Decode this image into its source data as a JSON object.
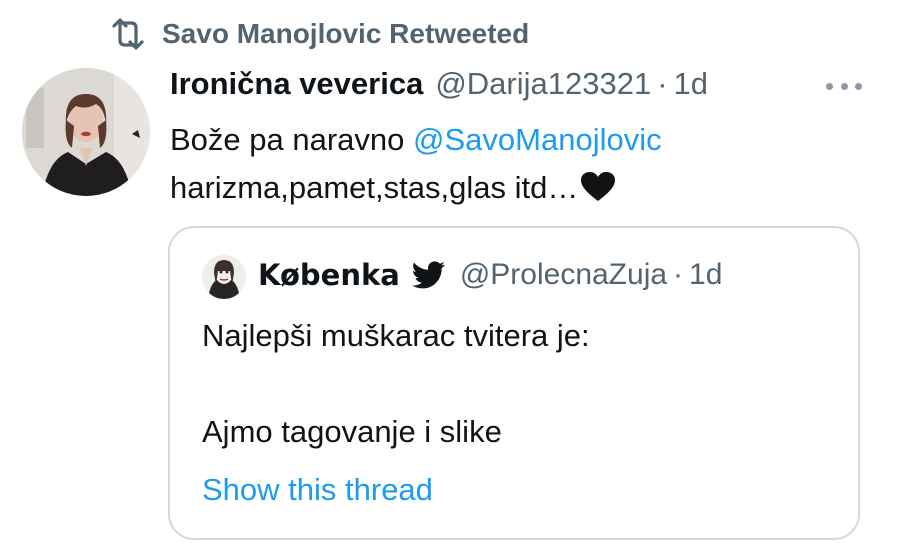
{
  "retweet": {
    "icon": "retweet-icon",
    "label": "Savo Manojlovic Retweeted"
  },
  "tweet": {
    "avatar_icon": "user-avatar",
    "display_name": "Ironična veverica",
    "handle": "@Darija123321",
    "separator": "·",
    "time": "1d",
    "more_icon": "more-options-icon",
    "text_line1_prefix": "Bože pa naravno ",
    "mention": "@SavoManojlovic",
    "text_line2": "harizma,pamet,stas,glas itd…",
    "emoji": "black-heart-icon"
  },
  "quoted_tweet": {
    "avatar_icon": "user-avatar",
    "display_name": "Købenka",
    "verified_icon": "twitter-bird-icon",
    "handle": "@ProlecnaZuja",
    "separator": "·",
    "time": "1d",
    "text_line1": "Najlepši muškarac tvitera je:",
    "text_line2": "Ajmo tagovanje i slike",
    "show_thread": "Show this thread"
  },
  "colors": {
    "text_primary": "#0f1419",
    "text_secondary": "#536471",
    "link": "#1d9bf0",
    "border": "#cfd9de"
  }
}
